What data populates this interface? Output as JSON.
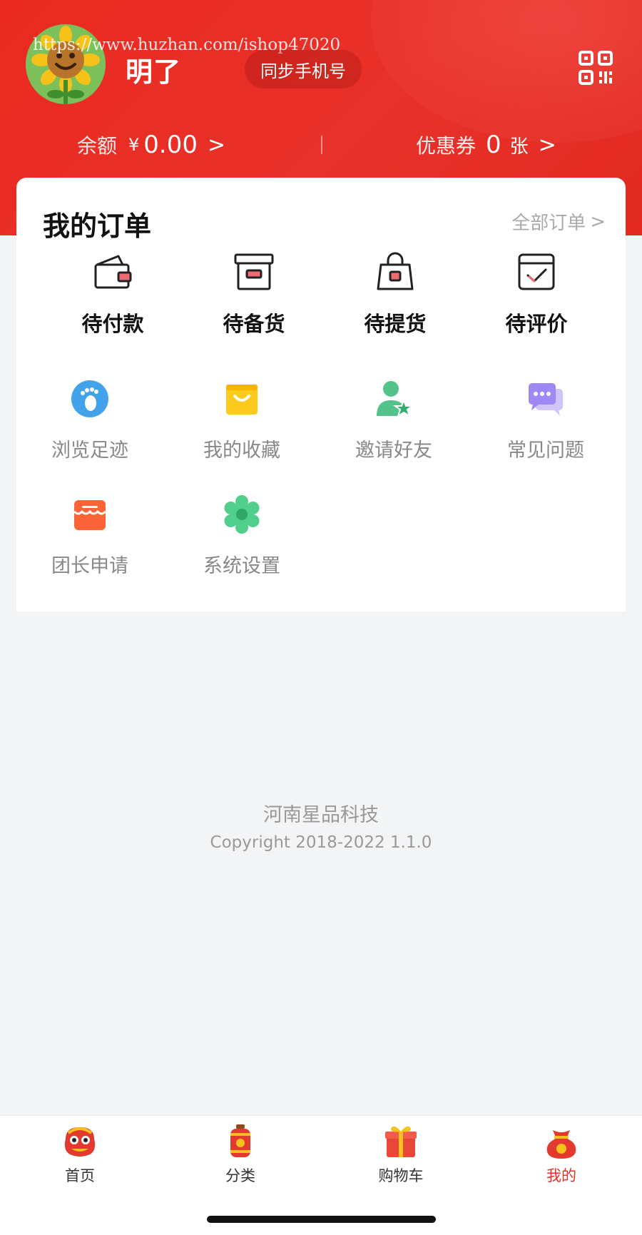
{
  "header": {
    "username": "明了",
    "watermark": "https://www.huzhan.com/ishop47020",
    "sync_label": "同步手机号",
    "balance": {
      "label": "余额",
      "currency": "¥",
      "value": "0.00",
      "chevron": ">"
    },
    "coupon": {
      "label": "优惠券",
      "value": "0",
      "unit": "张",
      "chevron": ">"
    }
  },
  "orders": {
    "title": "我的订单",
    "all_label": "全部订单",
    "all_chevron": ">",
    "items": [
      {
        "label": "待付款",
        "icon": "wallet-icon"
      },
      {
        "label": "待备货",
        "icon": "box-icon"
      },
      {
        "label": "待提货",
        "icon": "shopping-bag-icon"
      },
      {
        "label": "待评价",
        "icon": "calendar-check-icon"
      }
    ]
  },
  "tools": {
    "items": [
      {
        "label": "浏览足迹",
        "icon": "footprint-icon"
      },
      {
        "label": "我的收藏",
        "icon": "favorite-bag-icon"
      },
      {
        "label": "邀请好友",
        "icon": "invite-friend-icon"
      },
      {
        "label": "常见问题",
        "icon": "faq-chat-icon"
      },
      {
        "label": "团长申请",
        "icon": "store-icon"
      },
      {
        "label": "系统设置",
        "icon": "gear-icon"
      }
    ]
  },
  "footer": {
    "company": "河南星品科技",
    "copyright": "Copyright 2018-2022 1.1.0"
  },
  "tabbar": {
    "tabs": [
      {
        "label": "首页",
        "icon": "lion-dance-icon",
        "active": false
      },
      {
        "label": "分类",
        "icon": "lantern-icon",
        "active": false
      },
      {
        "label": "购物车",
        "icon": "gift-box-icon",
        "active": false
      },
      {
        "label": "我的",
        "icon": "lucky-bag-icon",
        "active": true
      }
    ]
  },
  "colors": {
    "brand_red": "#e8312a",
    "active_tab": "#e53127",
    "page_bg": "#f3f4f6"
  }
}
